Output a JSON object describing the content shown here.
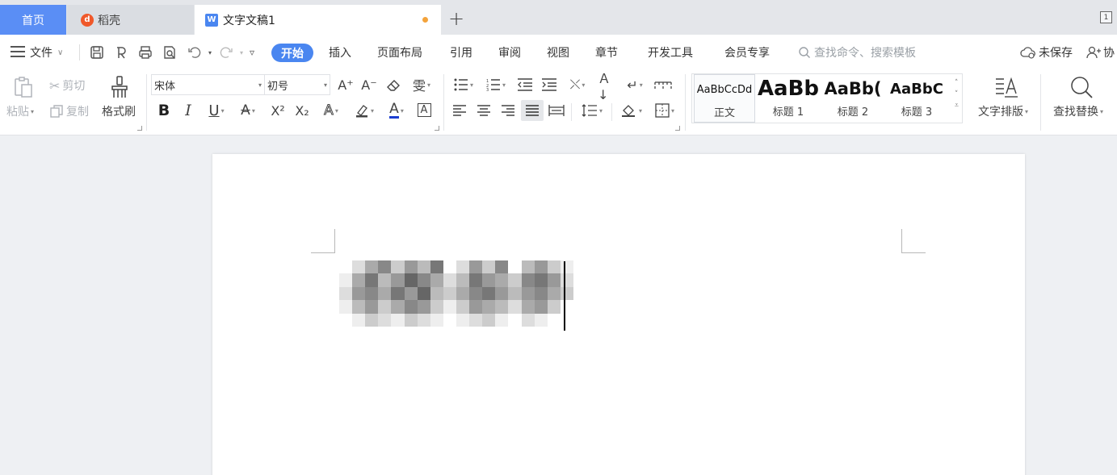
{
  "tabs": {
    "home": "首页",
    "daoke": "稻壳",
    "document": "文字文稿1",
    "doc_icon_letter": "W",
    "daoke_icon_letter": "d",
    "add": "+",
    "window_count": "1"
  },
  "menu": {
    "file": "文件",
    "tabs": [
      "开始",
      "插入",
      "页面布局",
      "引用",
      "审阅",
      "视图",
      "章节",
      "开发工具",
      "会员专享"
    ],
    "active_tab": "开始",
    "search_placeholder": "查找命令、搜索模板",
    "unsaved": "未保存",
    "collab": "协"
  },
  "ribbon": {
    "paste": "粘贴",
    "cut": "剪切",
    "copy": "复制",
    "format_painter": "格式刷",
    "font_name": "宋体",
    "font_size": "初号",
    "bold": "B",
    "italic": "I",
    "underline": "U",
    "strikethrough": "A",
    "superscript": "X²",
    "subscript": "X₂",
    "grow_font": "A⁺",
    "shrink_font": "A⁻",
    "font_color": "A",
    "char_border": "A",
    "styles": [
      {
        "sample": "AaBbCcDd",
        "name": "正文"
      },
      {
        "sample": "AaBb",
        "name": "标题 1"
      },
      {
        "sample": "AaBb(",
        "name": "标题 2"
      },
      {
        "sample": "AaBbC",
        "name": "标题 3"
      }
    ],
    "text_layout": "文字排版",
    "find_replace": "查找替换"
  },
  "colors": {
    "accent": "#4a86f0",
    "home_tab": "#5a8ef5",
    "unsaved_dot": "#f3a33b",
    "daoke": "#f0582a"
  },
  "document": {
    "content_redacted": true
  }
}
